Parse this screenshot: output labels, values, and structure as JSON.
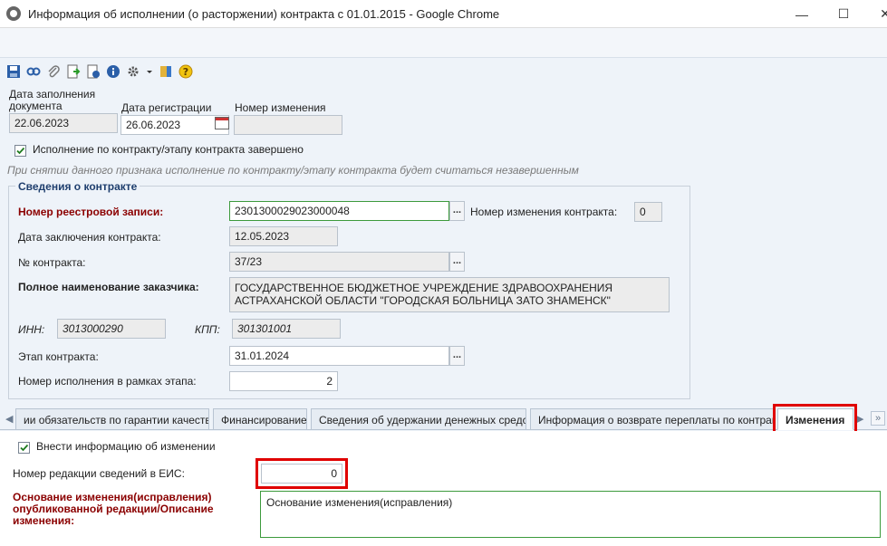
{
  "window": {
    "title": "Информация об исполнении (о расторжении) контракта с 01.01.2015 - Google Chrome",
    "minimize": "—",
    "maximize": "☐",
    "close": "✕"
  },
  "toolbar": {
    "icons": [
      "save-icon",
      "link-icon",
      "attach-icon",
      "export-icon",
      "info-export-icon",
      "info-icon",
      "settings-icon",
      "dropdown-icon",
      "book-icon",
      "help-icon"
    ]
  },
  "header": {
    "fill_date_label": "Дата заполнения документа",
    "fill_date_value": "22.06.2023",
    "reg_date_label": "Дата регистрации",
    "reg_date_value": "26.06.2023",
    "change_number_label": "Номер изменения",
    "change_number_value": ""
  },
  "completed": {
    "label": "Исполнение по контракту/этапу контракта завершено",
    "checked": true,
    "hint": "При снятии данного признака исполнение по контракту/этапу контракта будет считаться незавершенным"
  },
  "contract": {
    "group_title": "Сведения о контракте",
    "registry_label": "Номер реестровой записи:",
    "registry_value": "2301300029023000048",
    "contract_change_label": "Номер изменения контракта:",
    "contract_change_value": "0",
    "conclusion_date_label": "Дата заключения контракта:",
    "conclusion_date_value": "12.05.2023",
    "number_label": "№ контракта:",
    "number_value": "37/23",
    "customer_label": "Полное наименование заказчика:",
    "customer_value": "ГОСУДАРСТВЕННОЕ БЮДЖЕТНОЕ УЧРЕЖДЕНИЕ ЗДРАВООХРАНЕНИЯ АСТРАХАНСКОЙ ОБЛАСТИ \"ГОРОДСКАЯ БОЛЬНИЦА ЗАТО ЗНАМЕНСК\"",
    "inn_label": "ИНН:",
    "inn_value": "3013000290",
    "kpp_label": "КПП:",
    "kpp_value": "301301001",
    "stage_label": "Этап контракта:",
    "stage_value": "31.01.2024",
    "execution_number_label": "Номер исполнения в рамках этапа:",
    "execution_number_value": "2",
    "dots": "..."
  },
  "tabs": {
    "items": [
      "ии обязательств по гарантии качества",
      "Финансирование",
      "Сведения об удержании денежных средств",
      "Информация о возврате переплаты по контракту",
      "Изменения"
    ],
    "active": "Изменения"
  },
  "changes": {
    "enter_info_label": "Внести информацию об изменении",
    "enter_info_checked": true,
    "eis_revision_label": "Номер редакции сведений в ЕИС:",
    "eis_revision_value": "0",
    "reason_label": "Основание изменения(исправления) опубликованной редакции/Описание изменения:",
    "reason_value": "Основание изменения(исправления)"
  }
}
